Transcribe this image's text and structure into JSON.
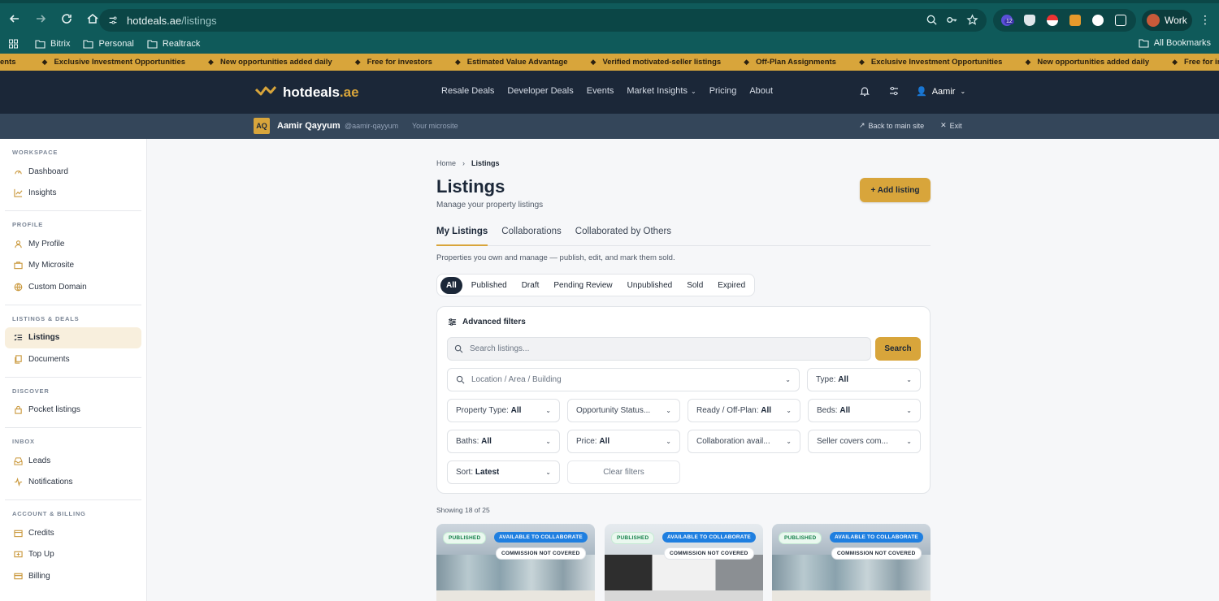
{
  "browser": {
    "url_host": "hotdeals.ae",
    "url_path": "/listings",
    "ext_badge": "12",
    "profile": "Work",
    "bookmarks": [
      "Bitrix",
      "Personal",
      "Realtrack"
    ],
    "all_bookmarks": "All Bookmarks"
  },
  "ticker": {
    "lead": "ents",
    "items": [
      "Exclusive Investment Opportunities",
      "New opportunities added daily",
      "Free for investors",
      "Estimated Value Advantage",
      "Verified motivated-seller listings",
      "Off-Plan Assignments",
      "Exclusive Investment Opportunities",
      "New opportunities added daily",
      "Free for in"
    ]
  },
  "header": {
    "logo_main": "hotdeals",
    "logo_tld": ".ae",
    "nav": [
      "Resale Deals",
      "Developer Deals",
      "Events",
      "Market Insights",
      "Pricing",
      "About"
    ],
    "user": "Aamir"
  },
  "subheader": {
    "initials": "AQ",
    "name": "Aamir Qayyum",
    "handle": "@aamir-qayyum",
    "microsite": "Your microsite",
    "back": "Back to main site",
    "exit": "Exit"
  },
  "sidebar": {
    "sections": [
      {
        "heading": "WORKSPACE",
        "items": [
          "Dashboard",
          "Insights"
        ]
      },
      {
        "heading": "PROFILE",
        "items": [
          "My Profile",
          "My Microsite",
          "Custom Domain"
        ]
      },
      {
        "heading": "LISTINGS & DEALS",
        "items": [
          "Listings",
          "Documents"
        ]
      },
      {
        "heading": "DISCOVER",
        "items": [
          "Pocket listings"
        ]
      },
      {
        "heading": "INBOX",
        "items": [
          "Leads",
          "Notifications"
        ]
      },
      {
        "heading": "ACCOUNT & BILLING",
        "items": [
          "Credits",
          "Top Up",
          "Billing"
        ]
      }
    ]
  },
  "main": {
    "crumb_home": "Home",
    "crumb_current": "Listings",
    "title": "Listings",
    "subtitle": "Manage your property listings",
    "add_button": "+ Add listing",
    "tabs": [
      "My Listings",
      "Collaborations",
      "Collaborated by Others"
    ],
    "tab_description": "Properties you own and manage — publish, edit, and mark them sold.",
    "status_pills": [
      "All",
      "Published",
      "Draft",
      "Pending Review",
      "Unpublished",
      "Sold",
      "Expired"
    ],
    "filters_title": "Advanced filters",
    "search_placeholder": "Search listings...",
    "search_button": "Search",
    "location_placeholder": "Location / Area / Building",
    "selects": {
      "type": {
        "label": "Type: ",
        "value": "All"
      },
      "property_type": {
        "label": "Property Type: ",
        "value": "All"
      },
      "opportunity": {
        "label": "Opportunity Status...",
        "value": ""
      },
      "ready": {
        "label": "Ready / Off-Plan: ",
        "value": "All"
      },
      "beds": {
        "label": "Beds: ",
        "value": "All"
      },
      "baths": {
        "label": "Baths: ",
        "value": "All"
      },
      "price": {
        "label": "Price: ",
        "value": "All"
      },
      "collab": {
        "label": "Collaboration avail...",
        "value": ""
      },
      "seller": {
        "label": "Seller covers com...",
        "value": ""
      },
      "sort": {
        "label": "Sort: ",
        "value": "Latest"
      }
    },
    "clear_filters": "Clear filters",
    "showing": "Showing 18 of 25",
    "cards": [
      {
        "status": "PUBLISHED",
        "collab": "AVAILABLE TO COLLABORATE",
        "commission": "COMMISSION NOT COVERED"
      },
      {
        "status": "PUBLISHED",
        "collab": "AVAILABLE TO COLLABORATE",
        "commission": "COMMISSION NOT COVERED"
      },
      {
        "status": "PUBLISHED",
        "collab": "AVAILABLE TO COLLABORATE",
        "commission": "COMMISSION NOT COVERED"
      }
    ]
  },
  "colors": {
    "accent": "#d8a53b",
    "navy": "#1b2738",
    "browser": "#0f5a5a",
    "collab_blue": "#1f7fe0"
  }
}
